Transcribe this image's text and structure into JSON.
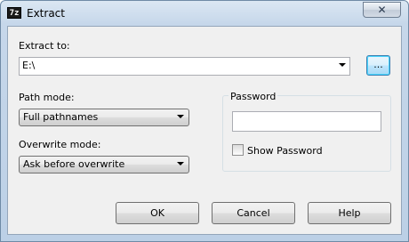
{
  "window": {
    "icon_text": "7z",
    "title": "Extract",
    "close_glyph": "✕"
  },
  "extract_to": {
    "label": "Extract to:",
    "value": "E:\\",
    "browse_label": "..."
  },
  "path_mode": {
    "label": "Path mode:",
    "selected": "Full pathnames"
  },
  "overwrite_mode": {
    "label": "Overwrite mode:",
    "selected": "Ask before overwrite"
  },
  "password": {
    "group_label": "Password",
    "value": "",
    "show_label": "Show Password",
    "show_checked": false
  },
  "buttons": {
    "ok": "OK",
    "cancel": "Cancel",
    "help": "Help"
  }
}
